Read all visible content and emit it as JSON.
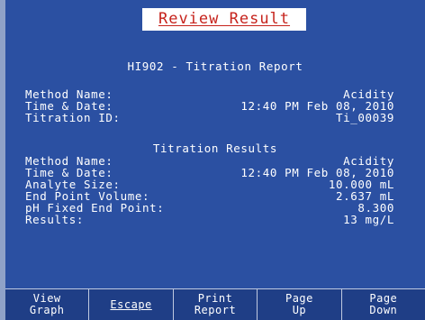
{
  "header": {
    "title": "Review Result"
  },
  "report": {
    "title": "HI902 - Titration Report",
    "rows": [
      {
        "label": "Method Name:",
        "value": "Acidity"
      },
      {
        "label": "Time & Date:",
        "value": "12:40 PM Feb 08, 2010"
      },
      {
        "label": "Titration ID:",
        "value": "Ti_00039"
      }
    ]
  },
  "results": {
    "title": "Titration Results",
    "rows": [
      {
        "label": "Method Name:",
        "value": "Acidity"
      },
      {
        "label": "Time & Date:",
        "value": "12:40 PM Feb 08, 2010"
      },
      {
        "label": "Analyte Size:",
        "value": "10.000 mL"
      },
      {
        "label": "End Point Volume:",
        "value": "2.637 mL"
      },
      {
        "label": "pH Fixed End Point:",
        "value": "8.300"
      },
      {
        "label": "Results:",
        "value": "13 mg/L"
      }
    ]
  },
  "softkeys": [
    {
      "line1": "View",
      "line2": "Graph"
    },
    {
      "line1": "Escape",
      "line2": ""
    },
    {
      "line1": "Print",
      "line2": "Report"
    },
    {
      "line1": "Page",
      "line2": "Up"
    },
    {
      "line1": "Page",
      "line2": "Down"
    }
  ]
}
